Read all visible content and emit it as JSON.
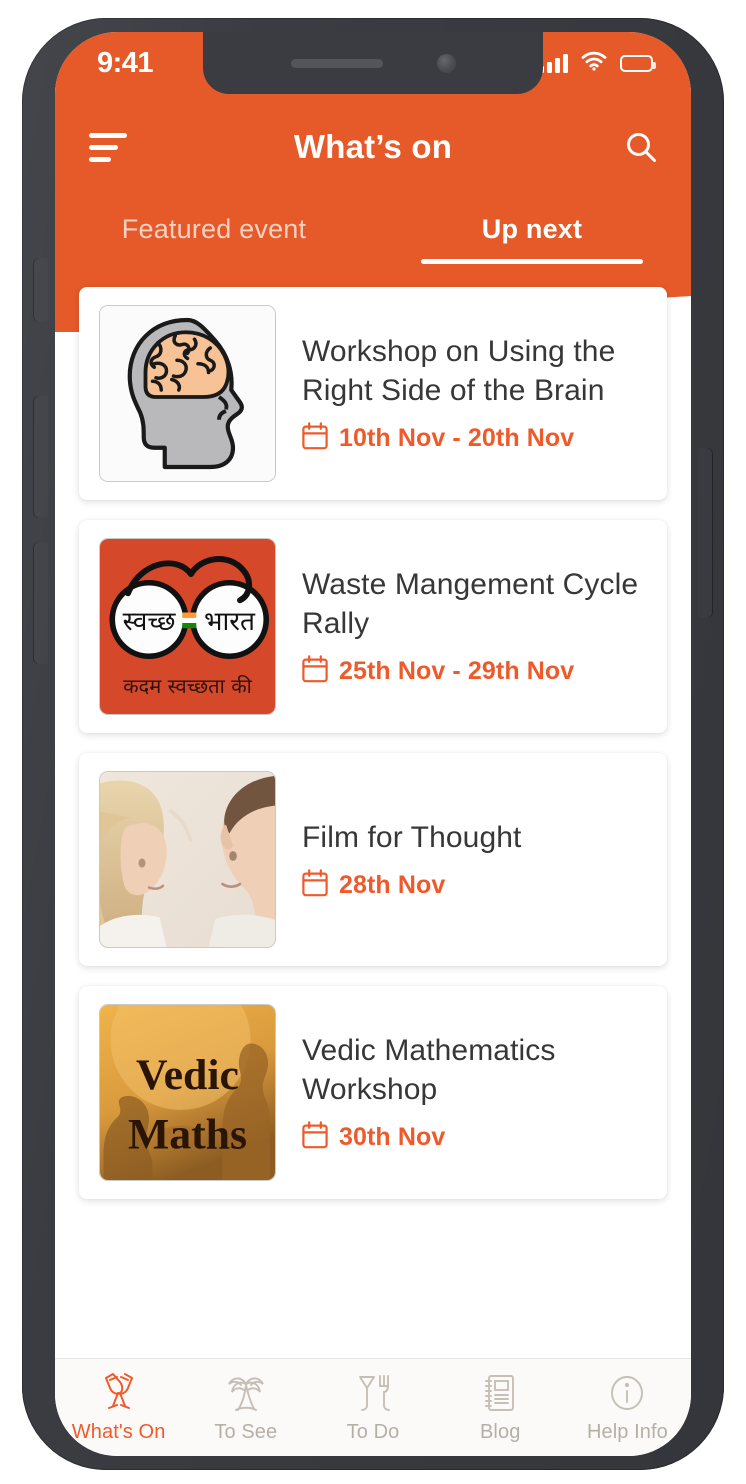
{
  "status_bar": {
    "time": "9:41",
    "signal_icon": "cellular-signal-icon",
    "wifi_icon": "wifi-icon",
    "battery_icon": "battery-full-icon"
  },
  "appbar": {
    "menu_icon": "hamburger-menu-icon",
    "title": "What’s on",
    "search_icon": "search-icon"
  },
  "tabs": [
    {
      "label": "Featured event",
      "active": false
    },
    {
      "label": "Up next",
      "active": true
    }
  ],
  "events": [
    {
      "title": "Workshop on Using the Right Side of the Brain",
      "date": "10th Nov - 20th Nov",
      "date_icon": "calendar-icon",
      "thumbnail": "brain-head-illustration"
    },
    {
      "title": "Waste Mangement Cycle Rally",
      "date": "25th Nov - 29th Nov",
      "date_icon": "calendar-icon",
      "thumbnail": "swachh-bharat-logo",
      "thumbnail_text": {
        "left": "स्वच्छ",
        "right": "भारत",
        "caption": "कदम स्वच्छता की"
      }
    },
    {
      "title": "Film for Thought",
      "date": "28th Nov",
      "date_icon": "calendar-icon",
      "thumbnail": "couple-photo"
    },
    {
      "title": "Vedic Mathematics Workshop",
      "date": "30th Nov",
      "date_icon": "calendar-icon",
      "thumbnail": "vedic-maths-poster",
      "thumbnail_text": {
        "line1": "Vedic",
        "line2": "Maths"
      }
    }
  ],
  "bottom_nav": [
    {
      "label": "What's On",
      "icon": "champagne-glasses-icon",
      "active": true
    },
    {
      "label": "To See",
      "icon": "palm-tree-icon",
      "active": false
    },
    {
      "label": "To Do",
      "icon": "glass-fork-icon",
      "active": false
    },
    {
      "label": "Blog",
      "icon": "notebook-icon",
      "active": false
    },
    {
      "label": "Help Info",
      "icon": "info-circle-icon",
      "active": false
    }
  ],
  "colors": {
    "brand_orange": "#e55a28",
    "accent_orange": "#ef5a2b",
    "title_text": "#373737",
    "nav_inactive": "#b6afa6",
    "frame": "#3a3c41"
  }
}
